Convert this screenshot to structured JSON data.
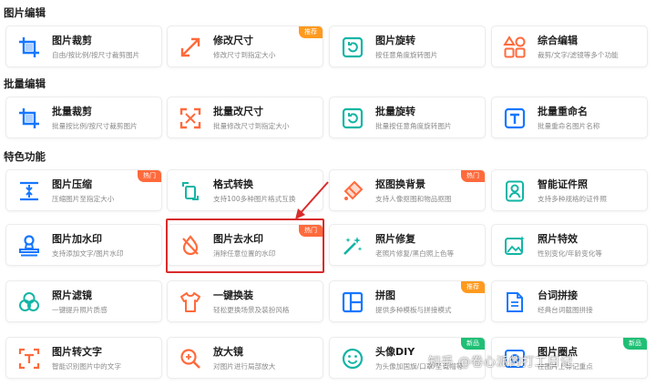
{
  "sections": {
    "image_edit": "图片编辑",
    "batch_edit": "批量编辑",
    "special": "特色功能"
  },
  "cards": {
    "crop": {
      "title": "图片裁剪",
      "sub": "自由/按比例/按尺寸裁剪图片"
    },
    "resize": {
      "title": "修改尺寸",
      "sub": "修改尺寸到指定大小",
      "badge": "推荐"
    },
    "rotate": {
      "title": "图片旋转",
      "sub": "按任意角度旋转图片"
    },
    "combo": {
      "title": "综合编辑",
      "sub": "裁剪/文字/滤镜等多个功能"
    },
    "batch_crop": {
      "title": "批量裁剪",
      "sub": "批量按比例/按尺寸裁剪图片"
    },
    "batch_resize": {
      "title": "批量改尺寸",
      "sub": "批量修改尺寸到指定大小"
    },
    "batch_rotate": {
      "title": "批量旋转",
      "sub": "批量按任意角度旋转图片"
    },
    "batch_rename": {
      "title": "批量重命名",
      "sub": "批量重命名图片名称"
    },
    "compress": {
      "title": "图片压缩",
      "sub": "压缩图片至指定大小",
      "badge": "热门"
    },
    "convert": {
      "title": "格式转换",
      "sub": "支持100多种图片格式互换"
    },
    "cutout": {
      "title": "抠图换背景",
      "sub": "支持人像抠图和物品抠图",
      "badge": "热门"
    },
    "idphoto": {
      "title": "智能证件照",
      "sub": "支持多种规格的证件照"
    },
    "watermark_add": {
      "title": "图片加水印",
      "sub": "支持添加文字/图片水印"
    },
    "watermark_remove": {
      "title": "图片去水印",
      "sub": "消除任意位置的水印",
      "badge": "热门"
    },
    "repair": {
      "title": "照片修复",
      "sub": "老照片修复/黑白照上色等"
    },
    "effects": {
      "title": "照片特效",
      "sub": "性别变化/年龄变化等"
    },
    "filter": {
      "title": "照片滤镜",
      "sub": "一键提升照片质感"
    },
    "outfit": {
      "title": "一键换装",
      "sub": "轻松更换场景及装扮风格"
    },
    "puzzle": {
      "title": "拼图",
      "sub": "提供多种模板与拼接模式",
      "badge": "推荐"
    },
    "lines": {
      "title": "台词拼接",
      "sub": "经典台词截图拼接"
    },
    "ocr": {
      "title": "图片转文字",
      "sub": "智能识别图片中的文字"
    },
    "magnifier": {
      "title": "放大镜",
      "sub": "对图片进行局部放大"
    },
    "avatar": {
      "title": "头像DIY",
      "sub": "为头像加国旗/口罩/圣诞帽等",
      "badge": "新品"
    },
    "marker": {
      "title": "图片圈点",
      "sub": "在图片上标记重点",
      "badge": "新品"
    }
  },
  "overlay": {
    "watermark_text": "知乎 @卷心派的打工日记"
  },
  "colors": {
    "icon_blue": "#1677ff",
    "icon_orange": "#ff6a3c",
    "icon_teal": "#12b5a5",
    "highlight_red": "#d92b2b",
    "badge_hot": "#ff6a3c",
    "badge_recommend": "#ff9a1f",
    "badge_new": "#1fbf75"
  },
  "icons": {
    "crop": "crop-icon",
    "resize": "resize-arrows-icon",
    "rotate": "rotate-icon",
    "combo": "shapes-icon",
    "batch_crop": "crop-icon",
    "batch_resize": "expand-icon",
    "batch_rotate": "rotate-icon",
    "batch_rename": "text-t-icon",
    "compress": "compress-icon",
    "convert": "convert-icon",
    "cutout": "eraser-icon",
    "idphoto": "portrait-icon",
    "watermark_add": "stamp-icon",
    "watermark_remove": "water-drop-slash-icon",
    "repair": "magic-wand-icon",
    "effects": "image-sparkle-icon",
    "filter": "overlap-circles-icon",
    "outfit": "tshirt-icon",
    "puzzle": "grid-layout-icon",
    "lines": "document-icon",
    "ocr": "text-scan-icon",
    "magnifier": "magnifier-icon",
    "avatar": "smiley-icon",
    "marker": "image-mark-icon"
  }
}
